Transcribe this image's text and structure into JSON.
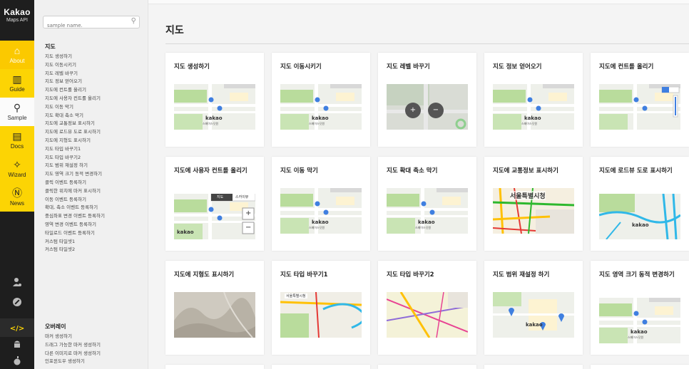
{
  "rail": {
    "brand": "Kakao",
    "brand_sub": "Maps API",
    "nav": [
      {
        "label": "About",
        "icon": "home-icon"
      },
      {
        "label": "Guide",
        "icon": "book-icon"
      },
      {
        "label": "Sample",
        "icon": "location-pin-icon"
      },
      {
        "label": "Docs",
        "icon": "document-icon"
      },
      {
        "label": "Wizard",
        "icon": "wizard-icon"
      },
      {
        "label": "News",
        "icon": "news-icon"
      }
    ],
    "tools": [
      "user-icon",
      "wrench-icon",
      "code-icon",
      "android-icon",
      "apple-icon"
    ],
    "colors": {
      "accent": "#fcd404",
      "rail_bg": "#1e1e1e"
    }
  },
  "sidebar": {
    "search_placeholder": "sample name.",
    "section_map": "지도",
    "map_links": [
      "지도 생성하기",
      "지도 이동시키기",
      "지도 레벨 바꾸기",
      "지도 정보 얻어오기",
      "지도에 컨트롤 올리기",
      "지도에 사용자 컨트롤 올리기",
      "지도 이동 막기",
      "지도 확대 축소 막기",
      "지도에 교통정보 표시하기",
      "지도에 로드뷰 도로 표시하기",
      "지도에 지형도 표시하기",
      "지도 타입 바꾸기1",
      "지도 타입 바꾸기2",
      "지도 범위 재설정 하기",
      "지도 영역 크기 동적 변경하기",
      "클릭 이벤트 등록하기",
      "클릭한 위치에 마커 표시하기",
      "이동 이벤트 등록하기",
      "확대, 축소 이벤트 등록하기",
      "중심좌표 변경 이벤트 등록하기",
      "영역 변경 이벤트 등록하기",
      "타일로드 이벤트 등록하기",
      "커스텀 타일셋1",
      "커스텀 타일셋2"
    ],
    "section_overlay": "오버레이",
    "overlay_links": [
      "마커 생성하기",
      "드래그 가능한 마커 생성하기",
      "다른 이미지로 마커 생성하기",
      "인포윈도우 생성하기"
    ]
  },
  "main": {
    "title": "지도",
    "cards": [
      {
        "title": "지도 생성하기",
        "thumb": "basic"
      },
      {
        "title": "지도 이동시키기",
        "thumb": "basic"
      },
      {
        "title": "지도 레벨 바꾸기",
        "thumb": "zoom"
      },
      {
        "title": "지도 정보 얻어오기",
        "thumb": "basic"
      },
      {
        "title": "지도에 컨트롤 올리기",
        "thumb": "control"
      },
      {
        "title": "지도에 사용자 컨트롤 올리기",
        "thumb": "custom"
      },
      {
        "title": "지도 이동 막기",
        "thumb": "basic"
      },
      {
        "title": "지도 확대 축소 막기",
        "thumb": "basic"
      },
      {
        "title": "지도에 교통정보 표시하기",
        "thumb": "traffic"
      },
      {
        "title": "지도에 로드뷰 도로 표시하기",
        "thumb": "roadview"
      },
      {
        "title": "지도에 지형도 표시하기",
        "thumb": "terrain"
      },
      {
        "title": "지도 타입 바꾸기1",
        "thumb": "overlay"
      },
      {
        "title": "지도 타입 바꾸기2",
        "thumb": "bike"
      },
      {
        "title": "지도 범위 재설정 하기",
        "thumb": "bounds"
      },
      {
        "title": "지도 영역 크기 동적 변경하기",
        "thumb": "basic"
      }
    ],
    "thumb_text": {
      "kakao": "kakao",
      "kakao_sub": "스페이스닷원",
      "seoul": "서울특별시청",
      "control_map": "지도",
      "control_sky": "스카이뷰",
      "zoom_in": "+",
      "zoom_out": "−"
    }
  }
}
